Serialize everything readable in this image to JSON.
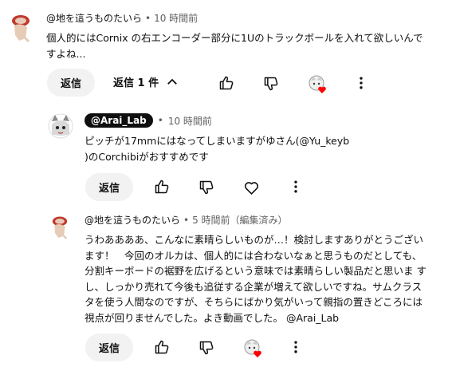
{
  "comment1": {
    "author": "@地を這うものたいら",
    "time": "10 時間前",
    "text_line1": "個人的にはCornix の右エンコーダー部分に1Uのトラックボールを入れて欲しいんで",
    "text_line2": "すよね...",
    "reply_label": "返信",
    "replies_label": "返信 1 件"
  },
  "reply1": {
    "author": "@Arai_Lab",
    "time": "10 時間前",
    "text_line1": "ピッチが17mmにはなってしまいますがゆさん(@Yu_keyb",
    "text_line2": ")のCorchibiがおすすめです",
    "reply_label": "返信"
  },
  "reply2": {
    "author": "@地を這うものたいら",
    "time": "5 時間前（編集済み）",
    "lines": [
      "うわああああ、こんなに素晴らしいものが…！検討しますありがとうござい",
      "ます！　今回のオルカは、個人的には合わないなぁと思うものだとしても、",
      "分割キーボードの裾野を広げるという意味では素晴らしい製品だと思いま す",
      "し、しっかり売れて今後も追従する企業が増えて欲しいですね。サムクラス",
      "タを使う人間なのですが、そちらにばかり気がいって親指の置きどころには",
      "視点が回りませんでした。よき動画でした。 @Arai_Lab"
    ],
    "reply_label": "返信"
  },
  "icons": {
    "like": "thumbs-up-icon",
    "dislike": "thumbs-down-icon",
    "heart": "heart-icon",
    "more": "more-vert-icon",
    "chevron": "chevron-up-icon"
  },
  "colors": {
    "heart_red": "#ff0000",
    "pill_bg": "#f2f2f2",
    "secondary_text": "#606060"
  }
}
